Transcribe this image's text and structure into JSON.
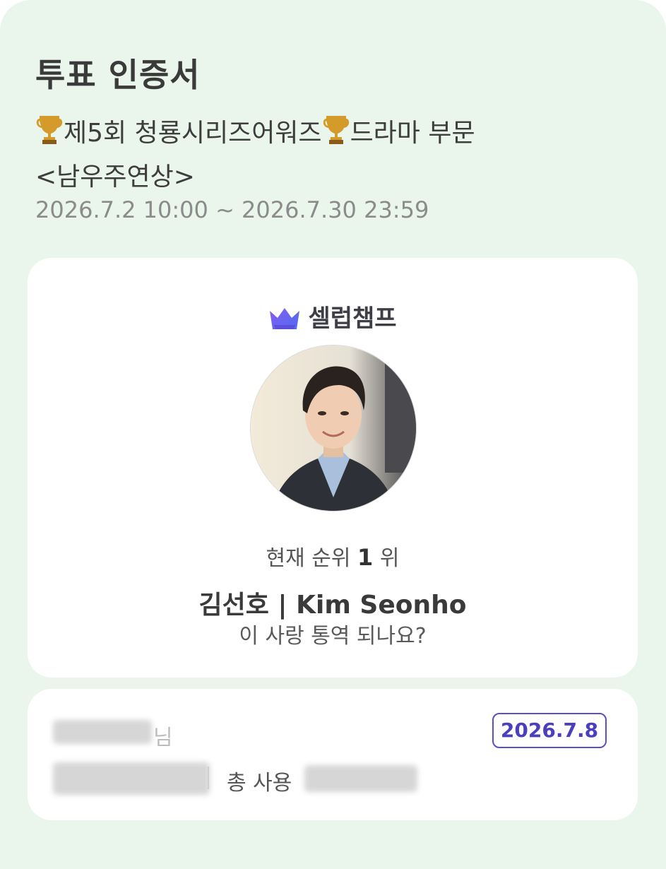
{
  "header": {
    "title": "투표 인증서",
    "event_name_part1": "제5회 청룡시리즈어워즈",
    "event_name_part2": "드라마 부문",
    "event_name_line2": "<남우주연상>",
    "period": "2026.7.2 10:00 ~ 2026.7.30 23:59"
  },
  "card": {
    "brand_name": "셀럽챔프",
    "rank_prefix": "현재 순위",
    "rank_number": "1",
    "rank_suffix": "위",
    "candidate_name": "김선호 | Kim Seonho",
    "candidate_work": "이 사랑 통역 되나요?"
  },
  "vote_info": {
    "user_suffix": "님",
    "date": "2026.7.8",
    "total_used_label": "총 사용"
  },
  "colors": {
    "background": "#eaf5ec",
    "card": "#ffffff",
    "accent": "#5a4fc9",
    "brand_gradient_start": "#7a5cf0",
    "brand_gradient_end": "#4a7cf2"
  },
  "icons": [
    "trophy-icon",
    "crown-logo-icon"
  ]
}
